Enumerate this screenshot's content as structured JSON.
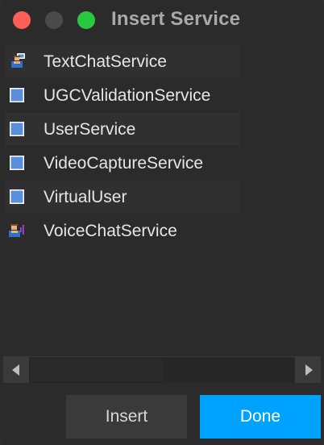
{
  "window": {
    "title": "Insert Service"
  },
  "services": [
    {
      "label": "TextChatService",
      "icon": "text-chat-icon",
      "shaded": true
    },
    {
      "label": "UGCValidationService",
      "icon": "service-square-icon",
      "shaded": false
    },
    {
      "label": "UserService",
      "icon": "service-square-icon",
      "shaded": true
    },
    {
      "label": "VideoCaptureService",
      "icon": "service-square-icon",
      "shaded": false
    },
    {
      "label": "VirtualUser",
      "icon": "service-square-icon",
      "shaded": true
    },
    {
      "label": "VoiceChatService",
      "icon": "voice-chat-icon",
      "shaded": false
    }
  ],
  "buttons": {
    "insert": "Insert",
    "done": "Done"
  },
  "colors": {
    "accent": "#00a2ff",
    "service_icon": "#5b8fdc"
  }
}
